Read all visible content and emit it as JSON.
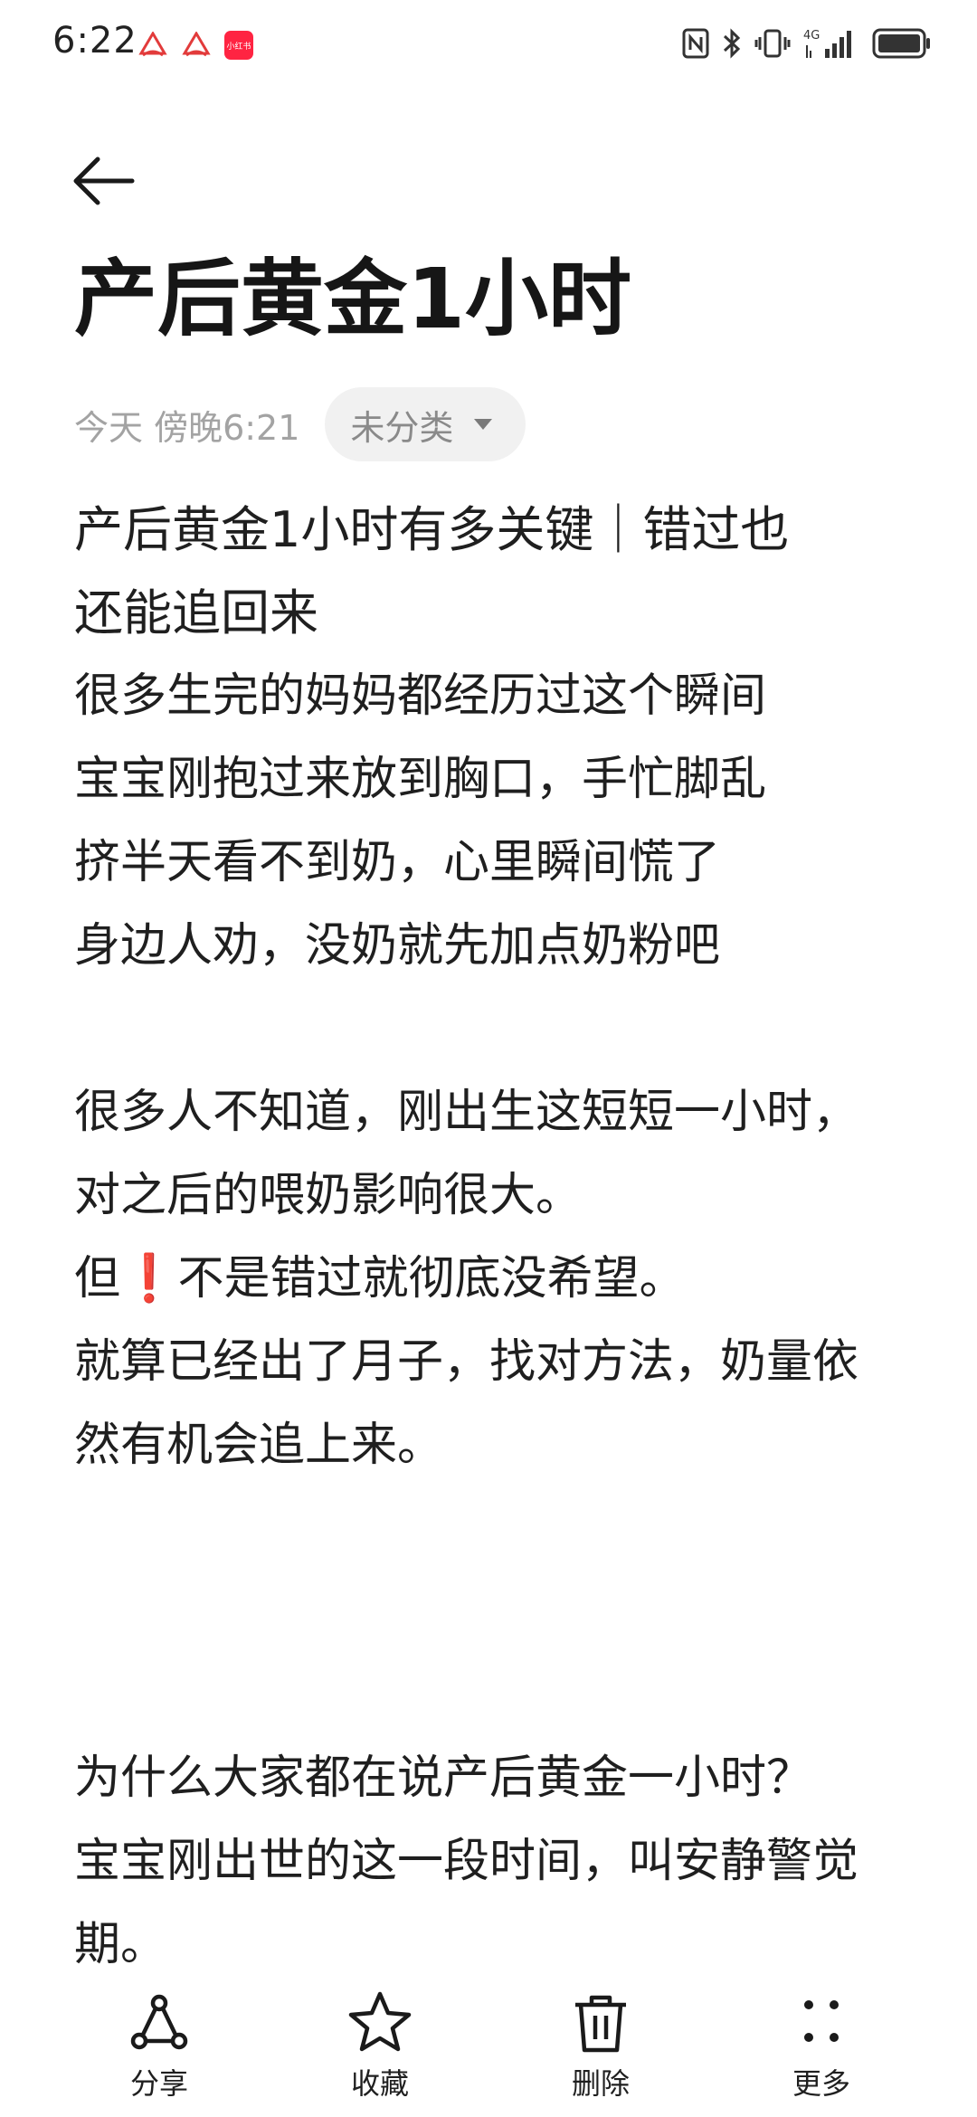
{
  "status_bar": {
    "time": "6:22",
    "app_icons": [
      "app-icon-1",
      "app-icon-2",
      "rednote-icon"
    ],
    "rednote_icon_text": "小红书",
    "network_label": "4G",
    "indicators": [
      "nfc-icon",
      "bluetooth-icon",
      "vibrate-icon",
      "signal-icon",
      "battery-icon"
    ]
  },
  "note": {
    "title": "产后黄金1小时",
    "date": "今天 傍晚6:21",
    "category": "未分类",
    "lines": [
      "产后黄金1小时有多关键｜错过也",
      "还能追回来",
      "很多生完的妈妈都经历过这个瞬间",
      "宝宝刚抱过来放到胸口，手忙脚乱",
      "挤半天看不到奶，心里瞬间慌了",
      "身边人劝，没奶就先加点奶粉吧",
      "",
      "很多人不知道，刚出生这短短一小时，",
      "对之后的喂奶影响很大。",
      "但❗不是错过就彻底没希望。",
      "就算已经出了月子，找对方法，奶量依",
      "然有机会追上来。",
      "",
      "",
      "",
      "为什么大家都在说产后黄金一小时？",
      "宝宝刚出世的这一段时间，叫安静警觉",
      "期。"
    ]
  },
  "toolbar": {
    "share": "分享",
    "favorite": "收藏",
    "delete": "删除",
    "more": "更多"
  }
}
